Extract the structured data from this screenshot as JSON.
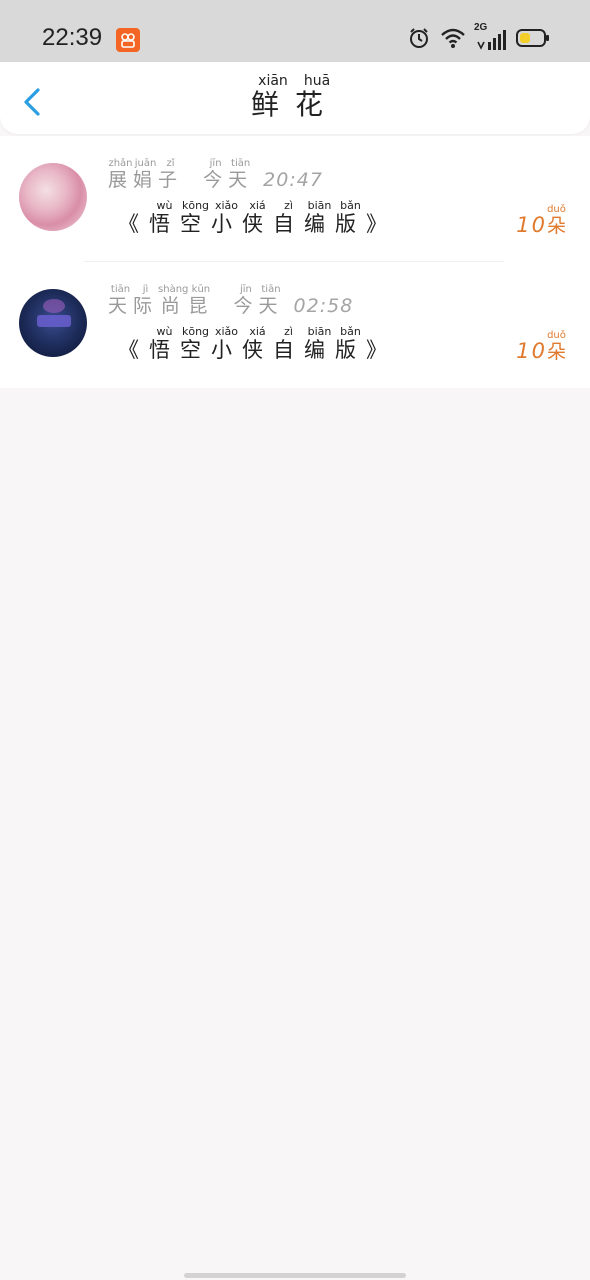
{
  "status_bar": {
    "time": "22:39",
    "network_label": "2G",
    "icons": [
      "app-badge-icon",
      "alarm-icon",
      "wifi-icon",
      "signal-icon",
      "battery-icon"
    ]
  },
  "header": {
    "title": "鲜花",
    "title_chars": [
      {
        "char": "鲜",
        "pinyin": "xiān"
      },
      {
        "char": "花",
        "pinyin": "huā"
      }
    ],
    "back_icon": "chevron-left-icon"
  },
  "items": [
    {
      "name": [
        {
          "char": "展",
          "pinyin": "zhǎn"
        },
        {
          "char": "娟",
          "pinyin": "juān"
        },
        {
          "char": "子",
          "pinyin": "zǐ"
        }
      ],
      "date": [
        {
          "char": "今",
          "pinyin": "jīn"
        },
        {
          "char": "天",
          "pinyin": "tiān"
        }
      ],
      "time": "20:47",
      "work": [
        {
          "char": "《",
          "pinyin": ""
        },
        {
          "char": "悟",
          "pinyin": "wù"
        },
        {
          "char": "空",
          "pinyin": "kōng"
        },
        {
          "char": "小",
          "pinyin": "xiǎo"
        },
        {
          "char": "侠",
          "pinyin": "xiá"
        },
        {
          "char": "自",
          "pinyin": "zì"
        },
        {
          "char": "编",
          "pinyin": "biān"
        },
        {
          "char": "版",
          "pinyin": "bǎn"
        },
        {
          "char": "》",
          "pinyin": ""
        }
      ],
      "count": "10",
      "unit": {
        "char": "朵",
        "pinyin": "duǒ"
      }
    },
    {
      "name": [
        {
          "char": "天",
          "pinyin": "tiān"
        },
        {
          "char": "际",
          "pinyin": "jì"
        },
        {
          "char": "尚",
          "pinyin": "shàng"
        },
        {
          "char": "昆",
          "pinyin": "kūn"
        }
      ],
      "date": [
        {
          "char": "今",
          "pinyin": "jīn"
        },
        {
          "char": "天",
          "pinyin": "tiān"
        }
      ],
      "time": "02:58",
      "work": [
        {
          "char": "《",
          "pinyin": ""
        },
        {
          "char": "悟",
          "pinyin": "wù"
        },
        {
          "char": "空",
          "pinyin": "kōng"
        },
        {
          "char": "小",
          "pinyin": "xiǎo"
        },
        {
          "char": "侠",
          "pinyin": "xiá"
        },
        {
          "char": "自",
          "pinyin": "zì"
        },
        {
          "char": "编",
          "pinyin": "biān"
        },
        {
          "char": "版",
          "pinyin": "bǎn"
        },
        {
          "char": "》",
          "pinyin": ""
        }
      ],
      "count": "10",
      "unit": {
        "char": "朵",
        "pinyin": "duǒ"
      }
    }
  ],
  "colors": {
    "accent_blue": "#2a9ee3",
    "count_orange": "#e07a2e",
    "status_bar_bg": "#d9d9d9",
    "page_bg": "#f8f6f7"
  }
}
